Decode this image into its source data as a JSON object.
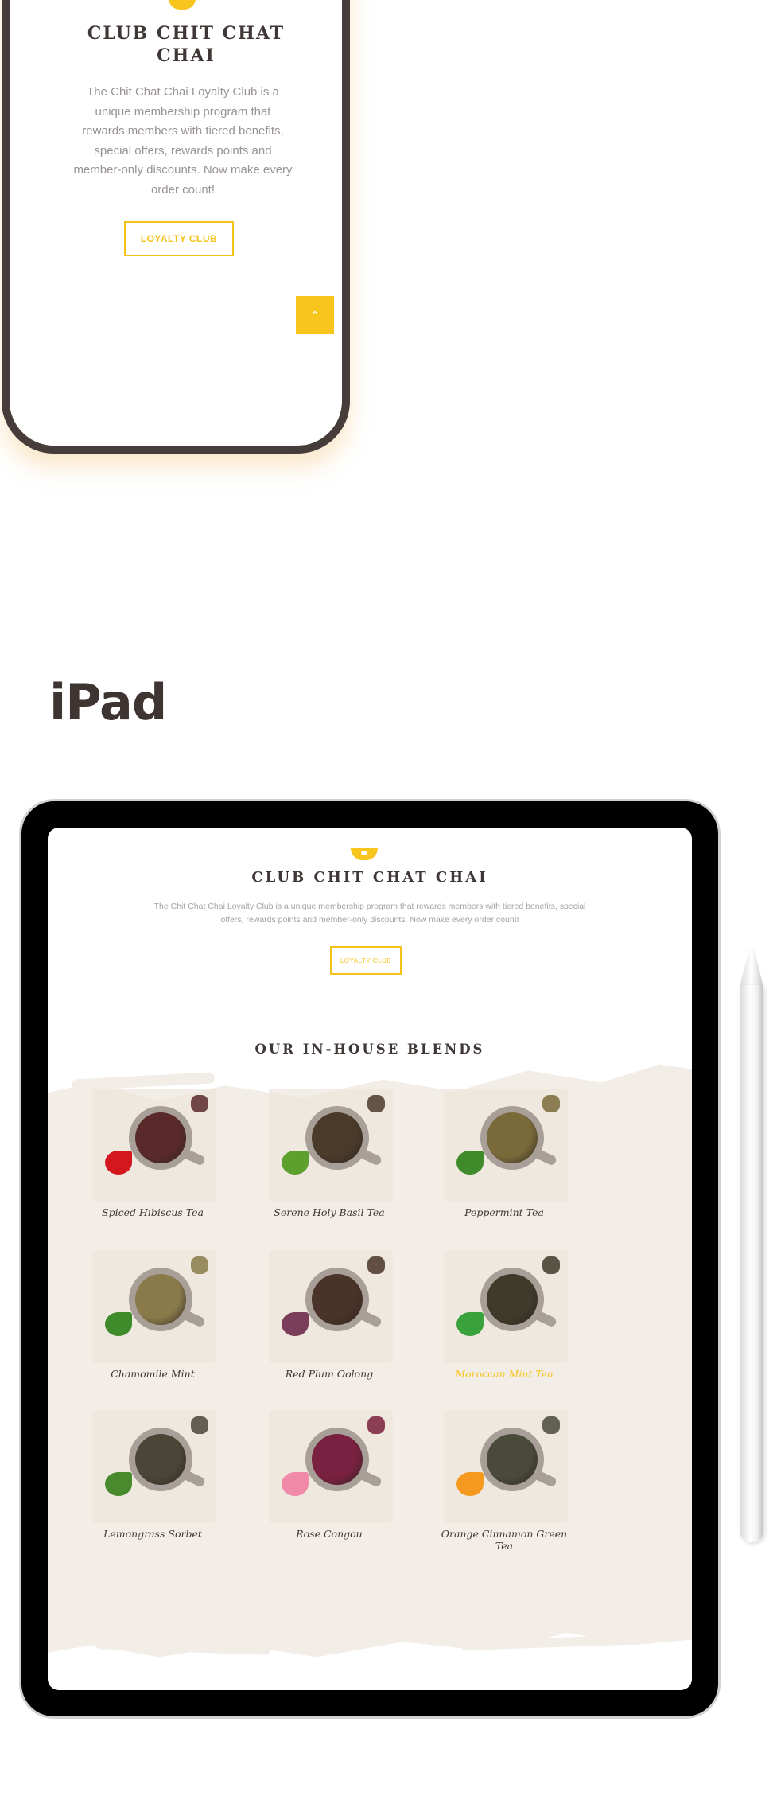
{
  "phone": {
    "title": "CLUB CHIT CHAT CHAI",
    "description": "The Chit Chat Chai Loyalty Club is a unique membership program that rewards members with tiered benefits, special offers, rewards points and member-only discounts. Now make every order count!",
    "button_label": "LOYALTY CLUB",
    "scroll_top_icon": "chevron-up-icon"
  },
  "section_heading": "iPad",
  "ipad": {
    "title": "CLUB CHIT CHAT CHAI",
    "description": "The Chit Chat Chai Loyalty Club is a unique membership program that rewards members with tiered benefits, special offers, rewards points and member-only discounts. Now make every order count!",
    "button_label": "LOYALTY CLUB",
    "blends_heading": "OUR IN-HOUSE BLENDS",
    "blends": [
      {
        "name": "Spiced Hibiscus Tea",
        "highlighted": false,
        "leaf_color": "#5a2a2a",
        "accent_color": "#d4161f"
      },
      {
        "name": "Serene Holy Basil Tea",
        "highlighted": false,
        "leaf_color": "#4a3a2a",
        "accent_color": "#5da02e"
      },
      {
        "name": "Peppermint Tea",
        "highlighted": false,
        "leaf_color": "#7a6a3a",
        "accent_color": "#3f8a2a"
      },
      {
        "name": "Chamomile Mint",
        "highlighted": false,
        "leaf_color": "#8a7a4a",
        "accent_color": "#3f8a2a"
      },
      {
        "name": "Red Plum Oolong",
        "highlighted": false,
        "leaf_color": "#4a3328",
        "accent_color": "#7a3e5a"
      },
      {
        "name": "Moroccan Mint Tea",
        "highlighted": true,
        "leaf_color": "#3f3a2a",
        "accent_color": "#3aa23a"
      },
      {
        "name": "Lemongrass Sorbet",
        "highlighted": false,
        "leaf_color": "#4a4536",
        "accent_color": "#4a8a2e"
      },
      {
        "name": "Rose Congou",
        "highlighted": false,
        "leaf_color": "#7a2040",
        "accent_color": "#f08aa8"
      },
      {
        "name": "Orange Cinnamon Green Tea",
        "highlighted": false,
        "leaf_color": "#4a4a3a",
        "accent_color": "#f59a1e"
      }
    ]
  },
  "colors": {
    "accent": "#f7c51d",
    "dark": "#3f3735",
    "highlight_text": "#f7c51d"
  }
}
